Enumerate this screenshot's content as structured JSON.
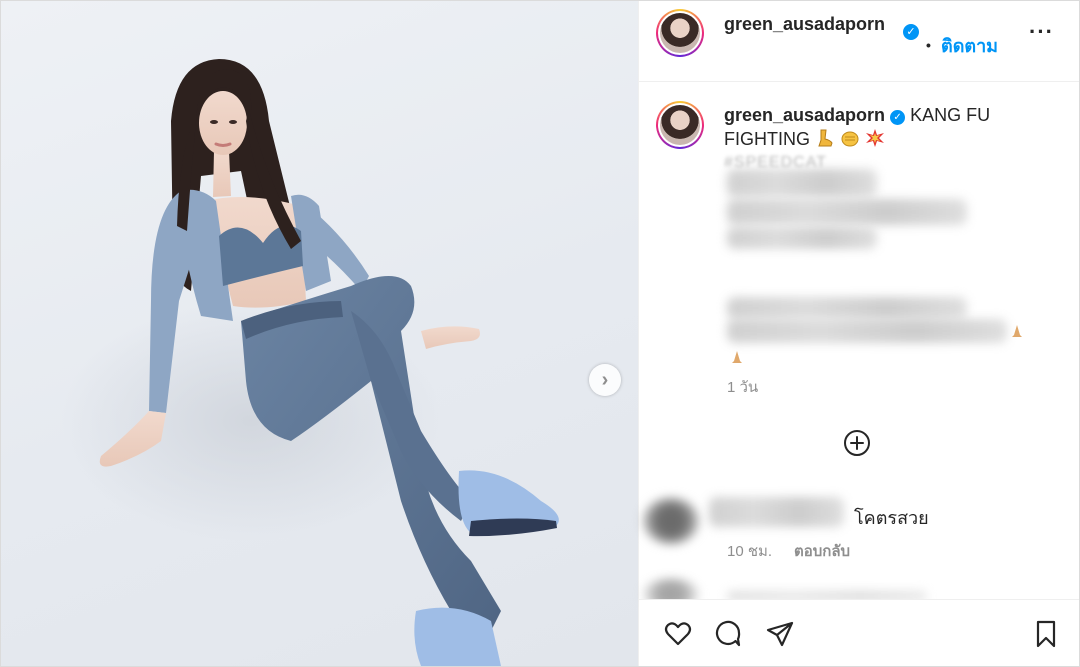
{
  "post": {
    "username": "green_ausadaporn",
    "follow_label": "ติดตาม",
    "dot": "•",
    "more_label": "···",
    "verified_glyph": "✓",
    "caption_user": "green_ausadaporn",
    "caption_text": "KANG FU FIGHTING",
    "caption_emojis": [
      "leg-emoji",
      "fist-emoji",
      "collision-emoji"
    ],
    "hashtag_peek": "#SPEEDCAT",
    "age": "1 วัน",
    "next_arrow": "›"
  },
  "comments": [
    {
      "text": "โคตรสวย",
      "time": "10 ชม.",
      "reply_label": "ตอบกลับ"
    }
  ],
  "icons": {
    "load_more": "plus-circle-icon",
    "actions": [
      "heart-icon",
      "comment-icon",
      "share-icon",
      "bookmark-icon"
    ]
  },
  "colors": {
    "accent": "#0095f6",
    "text": "#262626",
    "muted": "#8e8e8e",
    "border": "#efefef"
  }
}
